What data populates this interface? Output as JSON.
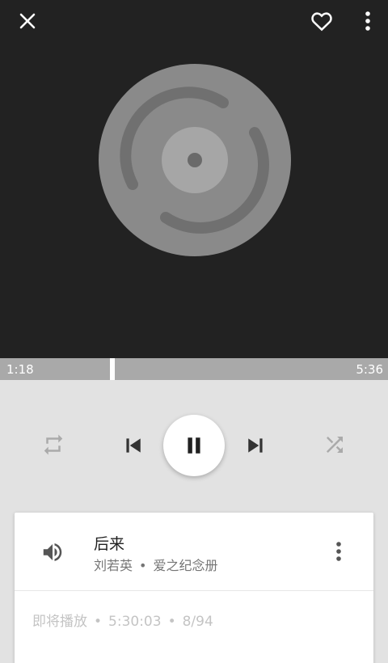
{
  "player": {
    "time_elapsed": "1:18",
    "time_total": "5:36",
    "progress_fraction": 0.29
  },
  "now_playing": {
    "title": "后来",
    "artist": "刘若英",
    "album": "爱之纪念册",
    "separator": "•"
  },
  "queue": {
    "label": "即将播放",
    "remaining_time": "5:30:03",
    "position": "8/94",
    "separator": "•"
  },
  "icons": {
    "close": "close-icon",
    "favorite": "heart-outline-icon",
    "more": "more-vert-icon",
    "repeat": "repeat-icon",
    "previous": "skip-previous-icon",
    "play_state": "pause-icon",
    "next": "skip-next-icon",
    "shuffle": "shuffle-icon",
    "speaker": "volume-icon",
    "item_more": "more-vert-icon"
  },
  "colors": {
    "art_background": "#222222",
    "disc": "#8a8a8a",
    "progress_track": "#a9a9a9",
    "controls_background": "#e2e2e2"
  }
}
